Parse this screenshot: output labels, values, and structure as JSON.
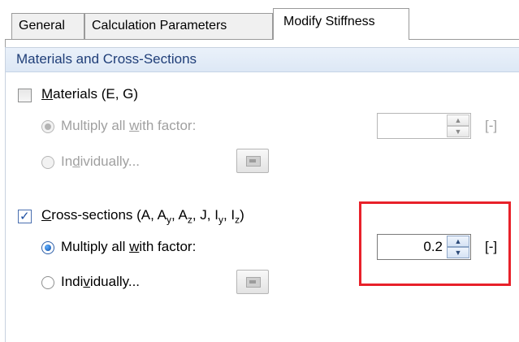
{
  "tabs": [
    {
      "label": "General"
    },
    {
      "label": "Calculation Parameters"
    },
    {
      "label": "Modify Stiffness",
      "active": true
    }
  ],
  "group": {
    "title": "Materials and Cross-Sections"
  },
  "materials": {
    "checkbox_label": "Materials (E, G)",
    "checked": false,
    "radio_multiply_label": "Multiply all with factor:",
    "radio_individually_label": "Individually...",
    "factor_value": "",
    "unit": "[-]",
    "enabled": false
  },
  "cross_sections": {
    "checkbox_label": "Cross-sections (A, Ay, Az, J, Iy, Iz)",
    "checked": true,
    "radio_multiply_label": "Multiply all with factor:",
    "radio_individually_label": "Individually...",
    "factor_value": "0.2",
    "unit": "[-]",
    "selected_option": "multiply",
    "enabled": true
  },
  "colors": {
    "group_title": "#1f3e78",
    "highlight": "#e8212a",
    "disabled_text": "#a0a0a0"
  },
  "icons": {
    "spin_up": "▲",
    "spin_down": "▼",
    "check": "✓"
  }
}
